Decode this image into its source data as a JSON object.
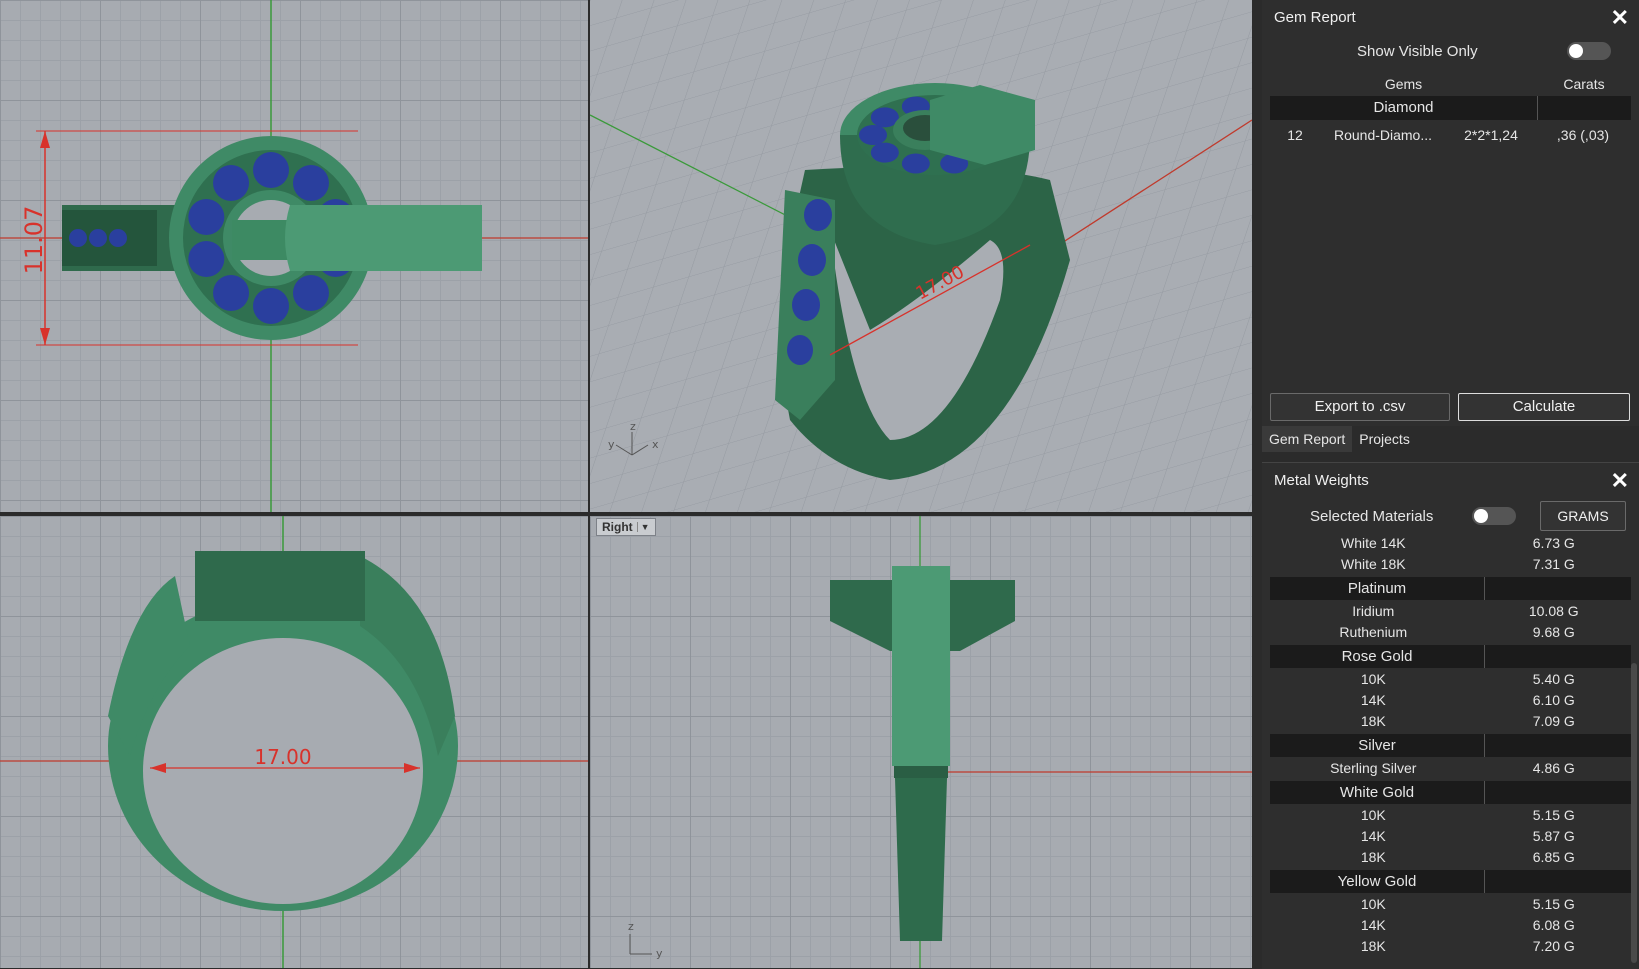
{
  "viewports": {
    "top": {
      "dimension": "11.07"
    },
    "perspective": {
      "dimension": "17.00",
      "axis_labels": [
        "y",
        "z",
        "x"
      ]
    },
    "front": {
      "dimension": "17.00"
    },
    "right": {
      "label": "Right",
      "axis_labels": [
        "z",
        "y"
      ]
    }
  },
  "gem_report": {
    "title": "Gem Report",
    "show_visible_label": "Show Visible Only",
    "col_gems": "Gems",
    "col_carats": "Carats",
    "group": "Diamond",
    "rows": [
      {
        "count": "12",
        "name": "Round-Diamo...",
        "size": "2*2*1,24",
        "carats": ",36 (,03)"
      }
    ],
    "export_label": "Export to .csv",
    "calculate_label": "Calculate",
    "tabs": [
      "Gem Report",
      "Projects"
    ]
  },
  "metal_weights": {
    "title": "Metal Weights",
    "selected_label": "Selected Materials",
    "unit_label": "GRAMS",
    "top_rows": [
      {
        "name": "White 14K",
        "value": "6.73 G"
      },
      {
        "name": "White 18K",
        "value": "7.31 G"
      }
    ],
    "groups": [
      {
        "name": "Platinum",
        "rows": [
          {
            "name": "Iridium",
            "value": "10.08 G"
          },
          {
            "name": "Ruthenium",
            "value": "9.68 G"
          }
        ]
      },
      {
        "name": "Rose Gold",
        "rows": [
          {
            "name": "10K",
            "value": "5.40 G"
          },
          {
            "name": "14K",
            "value": "6.10 G"
          },
          {
            "name": "18K",
            "value": "7.09 G"
          }
        ]
      },
      {
        "name": "Silver",
        "rows": [
          {
            "name": "Sterling Silver",
            "value": "4.86 G"
          }
        ]
      },
      {
        "name": "White Gold",
        "rows": [
          {
            "name": "10K",
            "value": "5.15 G"
          },
          {
            "name": "14K",
            "value": "5.87 G"
          },
          {
            "name": "18K",
            "value": "6.85 G"
          }
        ]
      },
      {
        "name": "Yellow Gold",
        "rows": [
          {
            "name": "10K",
            "value": "5.15 G"
          },
          {
            "name": "14K",
            "value": "6.08 G"
          },
          {
            "name": "18K",
            "value": "7.20 G"
          }
        ]
      }
    ]
  },
  "colors": {
    "model": "#3f8a66",
    "gem": "#2a3f9e",
    "dimension": "#d8322b",
    "axis_green": "#3a9a3a",
    "axis_red": "#c03a2c"
  }
}
